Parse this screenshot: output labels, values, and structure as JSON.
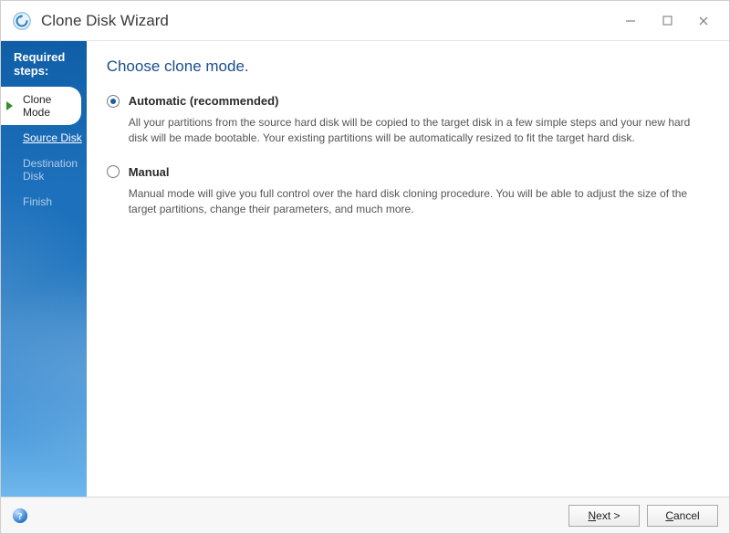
{
  "titlebar": {
    "title": "Clone Disk Wizard"
  },
  "sidebar": {
    "header": "Required steps:",
    "steps": [
      {
        "label": "Clone Mode",
        "state": "active"
      },
      {
        "label": "Source Disk",
        "state": "link"
      },
      {
        "label": "Destination Disk",
        "state": "disabled"
      },
      {
        "label": "Finish",
        "state": "disabled"
      }
    ]
  },
  "main": {
    "heading": "Choose clone mode.",
    "options": [
      {
        "id": "automatic",
        "title": "Automatic (recommended)",
        "selected": true,
        "description": "All your partitions from the source hard disk will be copied to the target disk in a few simple steps and your new hard disk will be made bootable. Your existing partitions will be automatically resized to fit the target hard disk."
      },
      {
        "id": "manual",
        "title": "Manual",
        "selected": false,
        "description": "Manual mode will give you full control over the hard disk cloning procedure. You will be able to adjust the size of the target partitions, change their parameters, and much more."
      }
    ]
  },
  "footer": {
    "next_label": "Next >",
    "next_hotkey": "N",
    "cancel_label": "Cancel",
    "cancel_hotkey": "C"
  }
}
